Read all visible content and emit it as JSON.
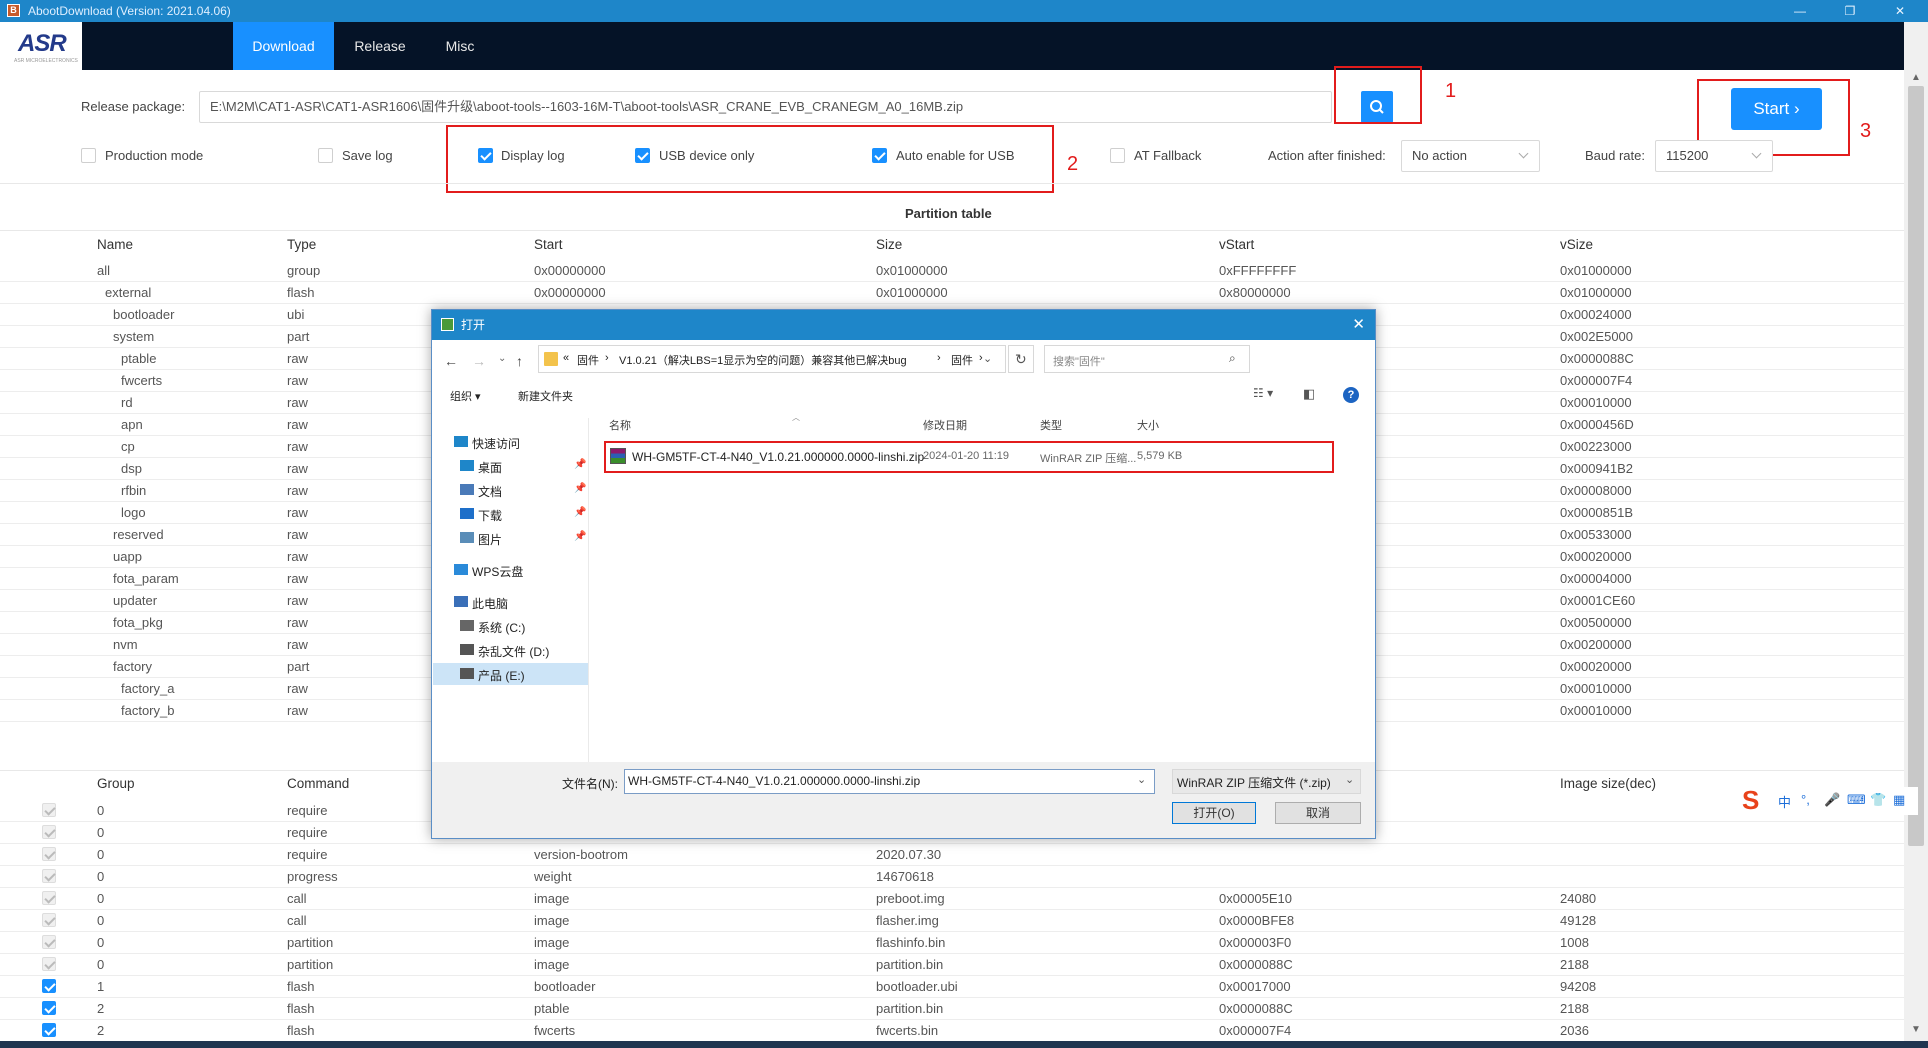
{
  "window": {
    "title": "AbootDownload (Version: 2021.04.06)",
    "app_icon": "B",
    "min": "—",
    "max": "❐",
    "close": "✕"
  },
  "logo": {
    "text": "ASR",
    "sub": "ASR MICROELECTRONICS"
  },
  "tabs": [
    {
      "label": "Download"
    },
    {
      "label": "Release"
    },
    {
      "label": "Misc"
    }
  ],
  "release": {
    "label": "Release package:",
    "value": "E:\\M2M\\CAT1-ASR\\CAT1-ASR1606\\固件升级\\aboot-tools--1603-16M-T\\aboot-tools\\ASR_CRANE_EVB_CRANEGM_A0_16MB.zip"
  },
  "start_label": "Start",
  "options": {
    "production_mode": "Production mode",
    "save_log": "Save log",
    "display_log": "Display log",
    "usb_device_only": "USB device only",
    "auto_enable_usb": "Auto enable for USB",
    "at_fallback": "AT Fallback",
    "action_label": "Action after finished:",
    "action_value": "No action",
    "baud_label": "Baud rate:",
    "baud_value": "115200"
  },
  "annotations": [
    "1",
    "2",
    "3"
  ],
  "partition": {
    "title": "Partition table",
    "headers": [
      "Name",
      "Type",
      "Start",
      "Size",
      "vStart",
      "vSize"
    ],
    "rows": [
      [
        "all",
        "group",
        "0x00000000",
        "0x01000000",
        "0xFFFFFFFF",
        "0x01000000"
      ],
      [
        "external",
        "flash",
        "0x00000000",
        "0x01000000",
        "0x80000000",
        "0x01000000"
      ],
      [
        "bootloader",
        "ubi",
        "",
        "",
        "",
        "0x00024000"
      ],
      [
        "system",
        "part",
        "",
        "",
        "",
        "0x002E5000"
      ],
      [
        "ptable",
        "raw",
        "",
        "",
        "",
        "0x0000088C"
      ],
      [
        "fwcerts",
        "raw",
        "",
        "",
        "",
        "0x000007F4"
      ],
      [
        "rd",
        "raw",
        "",
        "",
        "",
        "0x00010000"
      ],
      [
        "apn",
        "raw",
        "",
        "",
        "",
        "0x0000456D"
      ],
      [
        "cp",
        "raw",
        "",
        "",
        "",
        "0x00223000"
      ],
      [
        "dsp",
        "raw",
        "",
        "",
        "",
        "0x000941B2"
      ],
      [
        "rfbin",
        "raw",
        "",
        "",
        "",
        "0x00008000"
      ],
      [
        "logo",
        "raw",
        "",
        "",
        "",
        "0x0000851B"
      ],
      [
        "reserved",
        "raw",
        "",
        "",
        "",
        "0x00533000"
      ],
      [
        "uapp",
        "raw",
        "",
        "",
        "",
        "0x00020000"
      ],
      [
        "fota_param",
        "raw",
        "",
        "",
        "",
        "0x00004000"
      ],
      [
        "updater",
        "raw",
        "",
        "",
        "",
        "0x0001CE60"
      ],
      [
        "fota_pkg",
        "raw",
        "",
        "",
        "",
        "0x00500000"
      ],
      [
        "nvm",
        "raw",
        "",
        "",
        "",
        "0x00200000"
      ],
      [
        "factory",
        "part",
        "",
        "",
        "",
        "0x00020000"
      ],
      [
        "factory_a",
        "raw",
        "",
        "",
        "",
        "0x00010000"
      ],
      [
        "factory_b",
        "raw",
        "",
        "",
        "",
        "0x00010000"
      ]
    ]
  },
  "commands": {
    "headers": [
      "Group",
      "Command",
      "",
      "",
      "",
      "Image size(dec)"
    ],
    "rows": [
      [
        "0",
        "require",
        "",
        "",
        "",
        ""
      ],
      [
        "0",
        "require",
        "",
        "",
        "",
        ""
      ],
      [
        "0",
        "require",
        "version-bootrom",
        "2020.07.30",
        "",
        ""
      ],
      [
        "0",
        "progress",
        "weight",
        "14670618",
        "",
        ""
      ],
      [
        "0",
        "call",
        "image",
        "preboot.img",
        "0x00005E10",
        "24080"
      ],
      [
        "0",
        "call",
        "image",
        "flasher.img",
        "0x0000BFE8",
        "49128"
      ],
      [
        "0",
        "partition",
        "image",
        "flashinfo.bin",
        "0x000003F0",
        "1008"
      ],
      [
        "0",
        "partition",
        "image",
        "partition.bin",
        "0x0000088C",
        "2188"
      ],
      [
        "1",
        "flash",
        "bootloader",
        "bootloader.ubi",
        "0x00017000",
        "94208"
      ],
      [
        "2",
        "flash",
        "ptable",
        "partition.bin",
        "0x0000088C",
        "2188"
      ],
      [
        "2",
        "flash",
        "fwcerts",
        "fwcerts.bin",
        "0x000007F4",
        "2036"
      ]
    ]
  },
  "dialog": {
    "title": "打开",
    "close": "✕",
    "path": [
      "«",
      "固件",
      "›",
      "V1.0.21（解决LBS=1显示为空的问题）兼容其他已解决bug",
      "›",
      "固件",
      "›"
    ],
    "search_placeholder": "搜索\"固件\"",
    "organize": "组织 ▾",
    "new_folder": "新建文件夹",
    "nav": [
      {
        "label": "快速访问"
      },
      {
        "label": "桌面"
      },
      {
        "label": "文档"
      },
      {
        "label": "下载"
      },
      {
        "label": "图片"
      },
      {
        "label": "WPS云盘"
      },
      {
        "label": "此电脑"
      },
      {
        "label": "系统 (C:)"
      },
      {
        "label": "杂乱文件 (D:)"
      },
      {
        "label": "产品 (E:)"
      }
    ],
    "columns": [
      "名称",
      "修改日期",
      "类型",
      "大小"
    ],
    "file": {
      "name": "WH-GM5TF-CT-4-N40_V1.0.21.000000.0000-linshi.zip",
      "date": "2024-01-20 11:19",
      "type": "WinRAR ZIP 压缩...",
      "size": "5,579 KB"
    },
    "filename_label": "文件名(N):",
    "filename_value": "WH-GM5TF-CT-4-N40_V1.0.21.000000.0000-linshi.zip",
    "filter": "WinRAR ZIP 压缩文件 (*.zip)",
    "open_btn": "打开(O)",
    "cancel_btn": "取消"
  },
  "ime": {
    "items": [
      "中",
      "°,",
      "🎤",
      "⌨",
      "👕",
      "▦"
    ]
  }
}
